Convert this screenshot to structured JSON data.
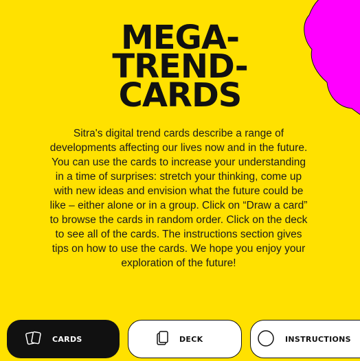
{
  "title_lines": [
    "MEGA-",
    "TREND-",
    "CARDS"
  ],
  "description": "Sitra's digital trend cards describe a range of developments affecting our lives now and in the future. You can use the cards to increase your understanding in a time of surprises: stretch your thinking, come up with new ideas and envision what the future could be like – either alone or in a group. Click on “Draw a card” to browse the cards in random order. Click on the deck to see all of the cards. The instructions section gives tips on how to use the cards. We hope you enjoy your exploration of the future!",
  "nav": {
    "cards_label": "CARDS",
    "deck_label": "DECK",
    "instructions_label": "INSTRUCTIONS"
  },
  "colors": {
    "background": "#FFE100",
    "blob": "#FF00FF",
    "text": "#111111"
  },
  "icons": {
    "cards": "cards-icon",
    "deck": "deck-icon",
    "instructions": "circle-icon"
  }
}
